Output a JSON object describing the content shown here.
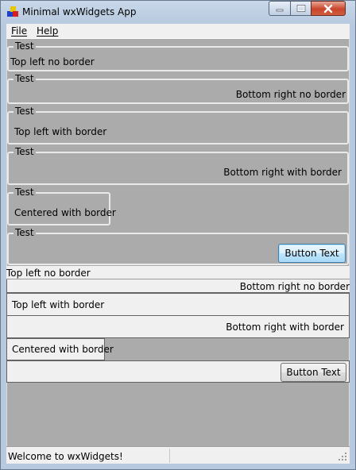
{
  "window": {
    "title": "Minimal wxWidgets App",
    "icon": "app-icon",
    "controls": [
      "minimize-icon",
      "maximize-icon",
      "close-icon"
    ]
  },
  "menu": {
    "items": [
      {
        "label": "File",
        "mnemonic": "F"
      },
      {
        "label": "Help",
        "mnemonic": "H"
      }
    ]
  },
  "static_boxes": [
    {
      "label": "Test",
      "content": "Top left no border"
    },
    {
      "label": "Test",
      "content": "Bottom right no border"
    },
    {
      "label": "Test",
      "content": "Top left with border"
    },
    {
      "label": "Test",
      "content": "Bottom right with border"
    },
    {
      "label": "Test",
      "content": "Centered with border"
    },
    {
      "label": "Test",
      "button": "Button Text"
    }
  ],
  "panels": [
    {
      "content": "Top left no border"
    },
    {
      "content": "Bottom right no border"
    },
    {
      "content": "Top left with border"
    },
    {
      "content": "Bottom right with border"
    },
    {
      "content": "Centered with border"
    },
    {
      "button": "Button Text"
    }
  ],
  "status": {
    "text": "Welcome to wxWidgets!"
  }
}
